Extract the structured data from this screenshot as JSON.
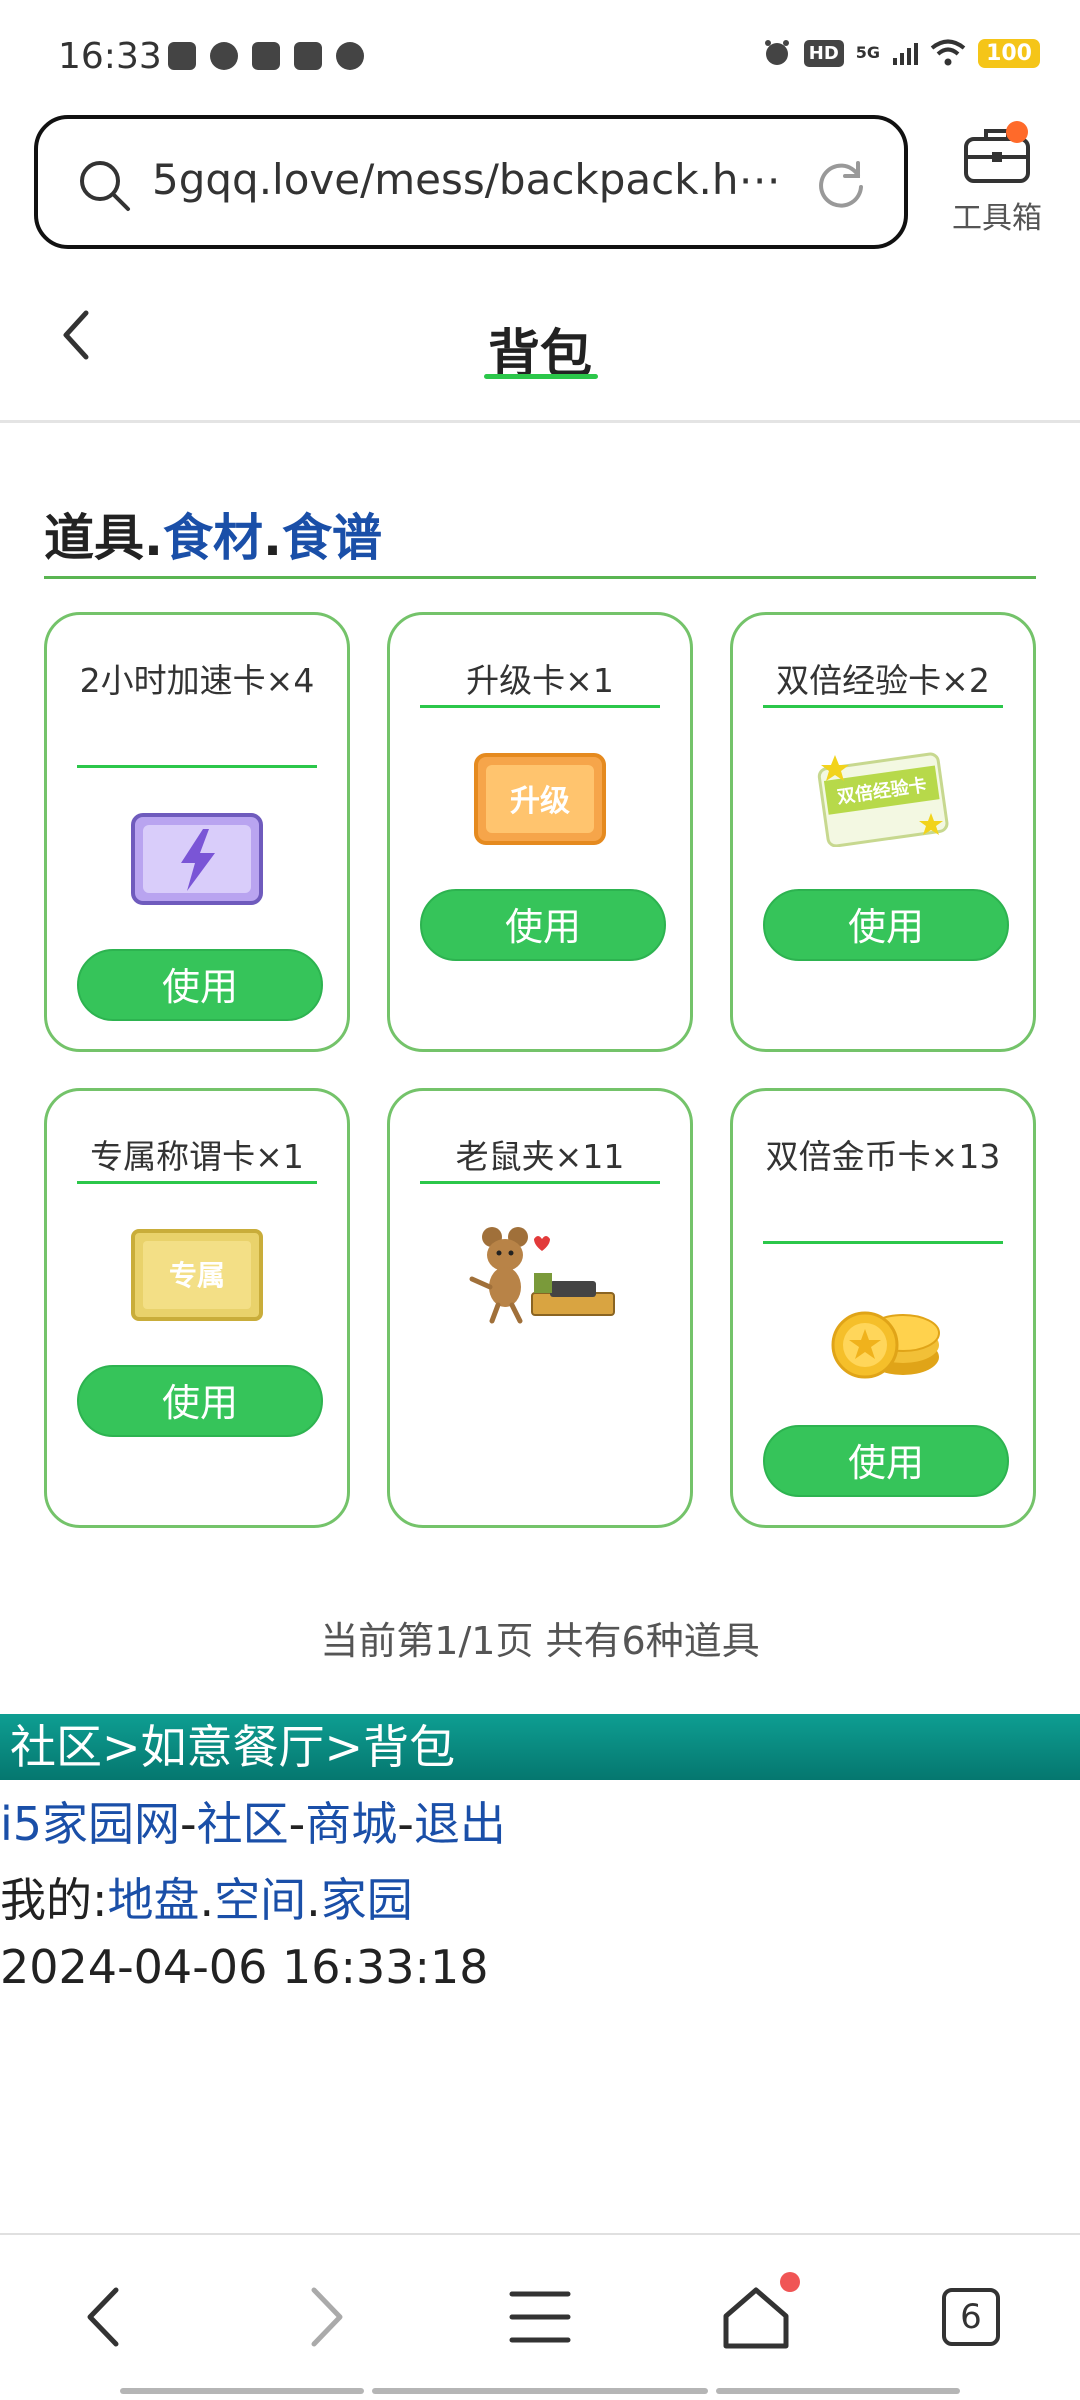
{
  "status_bar": {
    "time": "16:33",
    "network": "5G",
    "hd": "HD",
    "battery": "100"
  },
  "url_bar": {
    "url": "5gqq.love/mess/backpack.h⋯",
    "toolbox_label": "工具箱"
  },
  "header": {
    "title": "背包"
  },
  "section": {
    "tab_items": "道具",
    "sep1": ".",
    "tab_ingredients": "食材",
    "sep2": ".",
    "tab_recipes": "食谱"
  },
  "items": [
    {
      "name": "2小时加速卡×4",
      "icon": "lightning-card-icon",
      "button": "使用"
    },
    {
      "name": "升级卡×1",
      "icon": "upgrade-card-icon",
      "image_text": "升级",
      "button": "使用"
    },
    {
      "name": "双倍经验卡×2",
      "icon": "double-exp-card-icon",
      "image_text": "双倍经验卡",
      "button": "使用"
    },
    {
      "name": "专属称谓卡×1",
      "icon": "exclusive-title-card-icon",
      "image_text": "专属",
      "button": "使用"
    },
    {
      "name": "老鼠夹×11",
      "icon": "mousetrap-icon"
    },
    {
      "name": "双倍金币卡×13",
      "icon": "gold-coins-icon",
      "button": "使用"
    }
  ],
  "pagination": {
    "text": "当前第1/1页 共有6种道具"
  },
  "footer": {
    "breadcrumb": "社区>如意餐厅>背包",
    "link_home": "i5家园网",
    "link_community": "社区",
    "link_mall": "商城",
    "link_logout": "退出",
    "dash": "-",
    "my_prefix": "我的:",
    "link_territory": "地盘",
    "link_space": "空间",
    "link_homeland": "家园",
    "dot": ".",
    "datetime": "2024-04-06 16:33:18"
  },
  "bottom_nav": {
    "tabs_count": "6"
  },
  "colors": {
    "accent_green": "#36c45a",
    "card_border": "#74c36a",
    "link_blue": "#1a4fa8",
    "teal_bar": "#0e9e92"
  }
}
